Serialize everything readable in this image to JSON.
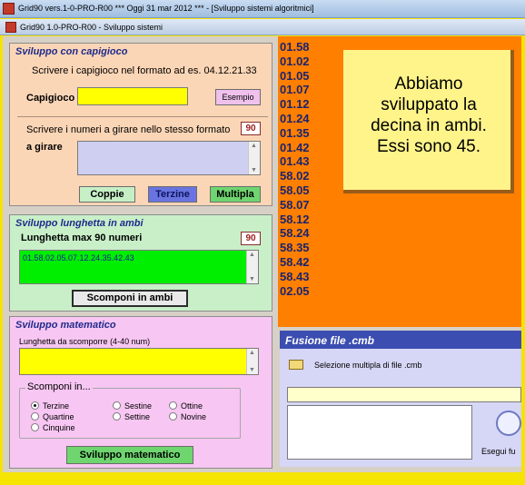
{
  "window": {
    "title": "Grid90 vers.1-0-PRO-R00  ***  Oggi 31 mar 2012  ***  - [Sviluppo sistemi algoritmici]",
    "subtitle": "Grid90 1.0-PRO-R00 - Sviluppo sistemi"
  },
  "capigioco_panel": {
    "title": "Sviluppo con capigioco",
    "instruction": "Scrivere i capigioco nel formato ad es. 04.12.21.33",
    "capigioco_label": "Capigioco",
    "capigioco_value": "",
    "esempio_button": "Esempio",
    "numbers_instruction": "Scrivere i numeri a girare nello stesso formato",
    "numbers_count": "90",
    "a_girare_label": "a girare",
    "a_girare_value": "",
    "coppie_button": "Coppie",
    "terzine_button": "Terzine",
    "multipla_button": "Multipla"
  },
  "lunghetta_panel": {
    "title": "Sviluppo lunghetta in ambi",
    "length_label": "Lunghetta max 90 numeri",
    "count": "90",
    "value": "01.58.02.05.07.12.24.35.42.43",
    "scomponi_button": "Scomponi in ambi"
  },
  "matematico_panel": {
    "title": "Sviluppo matematico",
    "length_label": "Lunghetta da scomporre (4-40 num)",
    "value": "",
    "group_title": "Scomponi in...",
    "options": [
      {
        "label": "Terzine",
        "selected": true
      },
      {
        "label": "Quartine",
        "selected": false
      },
      {
        "label": "Cinquine",
        "selected": false
      },
      {
        "label": "Sestine",
        "selected": false
      },
      {
        "label": "Settine",
        "selected": false
      },
      {
        "label": "Ottine",
        "selected": false
      },
      {
        "label": "Novine",
        "selected": false
      }
    ],
    "run_button": "Sviluppo matematico"
  },
  "ambi_list": [
    "01.58",
    "01.02",
    "01.05",
    "01.07",
    "01.12",
    "01.24",
    "01.35",
    "01.42",
    "01.43",
    "58.02",
    "58.05",
    "58.07",
    "58.12",
    "58.24",
    "58.35",
    "58.42",
    "58.43",
    "02.05"
  ],
  "note": {
    "text_lines": [
      "Abbiamo",
      "sviluppato la",
      "decina in ambi.",
      "Essi sono 45."
    ]
  },
  "fusione_panel": {
    "title": "Fusione file .cmb",
    "selection_label": "Selezione multipla di file .cmb",
    "path_value": "",
    "run_label": "Esegui fu"
  },
  "colors": {
    "accent_orange": "#ff7f00",
    "pair_text": "#1a2470",
    "note_bg": "#fff48a",
    "background": "#f5e400"
  }
}
